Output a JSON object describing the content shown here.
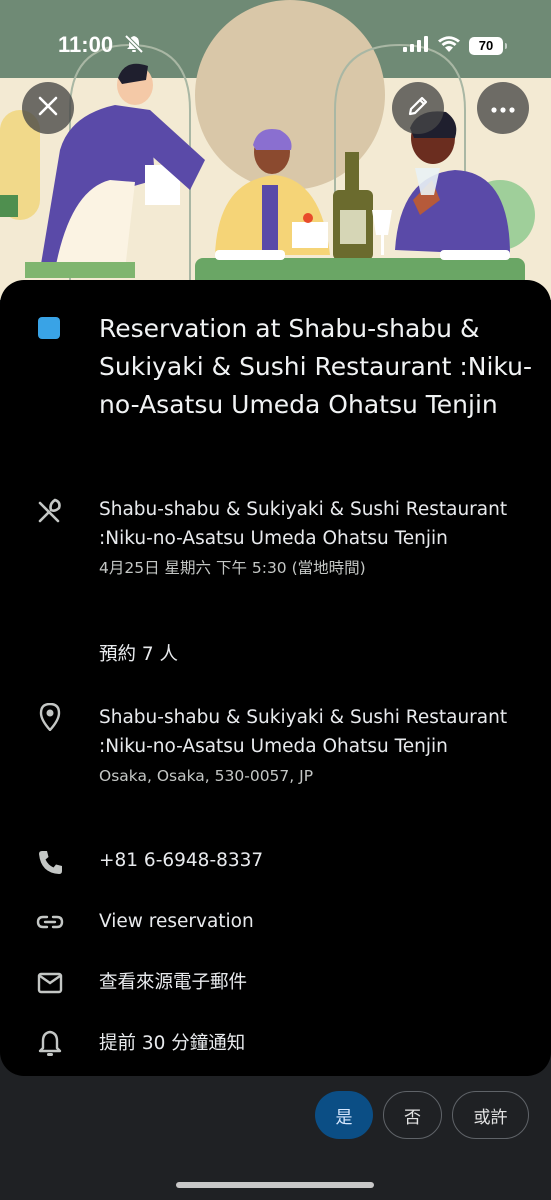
{
  "status_bar": {
    "time": "11:00",
    "battery": "70"
  },
  "event": {
    "title": "Reservation at Shabu-shabu & Sukiyaki & Sushi Restaurant :Niku-no-Asatsu Umeda Ohatsu Tenjin",
    "color": "#39a3e6"
  },
  "reservation": {
    "name": "Shabu-shabu & Sukiyaki & Sushi Restaurant :Niku-no-Asatsu Umeda Ohatsu Tenjin",
    "datetime": "4月25日 星期六 下午 5:30 (當地時間)",
    "party": "預約 7 人"
  },
  "location": {
    "name": "Shabu-shabu & Sukiyaki & Sushi Restaurant :Niku-no-Asatsu Umeda Ohatsu Tenjin",
    "address": "Osaka, Osaka, 530-0057, JP"
  },
  "phone": "+81 6-6948-8337",
  "link": "View reservation",
  "email": "查看來源電子郵件",
  "reminder": "提前 30 分鐘通知",
  "rsvp": {
    "yes": "是",
    "no": "否",
    "maybe": "或許"
  }
}
